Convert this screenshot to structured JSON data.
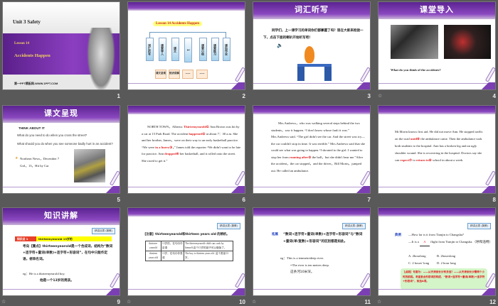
{
  "slides": [
    {
      "number": "1",
      "title": "Unit 3  Safety",
      "lesson": "Lesson 14",
      "subtitle": "Accidents Happen",
      "footer": "第一PPT模板网-WWW.1PPT.COM"
    },
    {
      "number": "2",
      "banner": "Lesson 14   Accidents Happen",
      "boxes": [
        "词汇听写",
        "课堂导入",
        "课文",
        "1",
        "课堂小结",
        "课堂练习",
        "课后作业"
      ],
      "sub_boxes": [
        "课文呈现",
        "知识讲解",
        "——",
        "——"
      ]
    },
    {
      "number": "3",
      "header": "词汇听写",
      "text": "同学们，上一课学习的单词你们都掌握了吗？现在大家来检验一下，点击下面的喇叭开始听写吧！"
    },
    {
      "number": "4",
      "header": "课堂导入",
      "caption": "What do you think of the accidents?"
    },
    {
      "number": "5",
      "header": "课文呈现",
      "think": "THINK  ABOUT  IT",
      "q1": "What do you need to do when you cross the street?",
      "q2": "What should you do when you see someone badly hurt in an accident?",
      "news1": "Northern News，December 7",
      "news2": "Girl，13，Hit by Car"
    },
    {
      "number": "6",
      "segments": [
        {
          "t": "NORTH TOWN，Alberta: "
        },
        {
          "t": "Thirteenyearold①",
          "hl": true
        },
        {
          "t": " Ann Brown was hit by a car at 15 Park Road. The accident "
        },
        {
          "t": "happened②",
          "hl": true
        },
        {
          "t": " at about 7：30 a.m. She and her brother, James，were on their way to an early basketball practice. “We were "
        },
        {
          "t": "in a hurry③",
          "hl": true
        },
        {
          "t": "，” James told the reporter.“We didn't want to be late for practice. Ann "
        },
        {
          "t": "dropped④",
          "hl": true
        },
        {
          "t": " her basketball, and it rolled onto the street. She raced to get it.”"
        }
      ]
    },
    {
      "number": "7",
      "segments": [
        {
          "t": "Mrs.Andrews，who was walking several steps behind the two students，saw it happen. “I don't know whose fault it was.” Mrs.Andrews said. “The girl didn't see the car. And the street was icy—the car couldn't stop in time. It was terrible.” Mrs.Andrews said that she could see what was going to happen.“I shouted to the girl. I wanted to stop her from "
        },
        {
          "t": "running after⑤",
          "hl": true
        },
        {
          "t": " the ball，but she didn't hear me.”After the accident，the car stopped，and the driver，Bill Morin，jumped out. He called an ambulance."
        }
      ]
    },
    {
      "number": "8",
      "segments": [
        {
          "t": "Mr.Morin knows first aid. He did not move Ann. He stopped traffic on the road "
        },
        {
          "t": "until⑥",
          "hl": true
        },
        {
          "t": " the ambulance came. Then the ambulance took both students to the hospital. Ann has a broken leg and an ugly shoulder wound. She is recovering in the hospital. Doctors say she can "
        },
        {
          "t": "expect⑦",
          "hl": true
        },
        {
          "t": " to "
        },
        {
          "t": "return to⑧",
          "hl": true
        },
        {
          "t": " school in about a week."
        }
      ]
    },
    {
      "number": "9",
      "header": "知识讲解",
      "tag": "精讲点拨 (冀教)",
      "point_label": "知识点 1",
      "point": "thirteenyearold  13岁的",
      "body": "考向【重点】thirteenyearold是一个合成词，结构为“数词+连字符+量词(单数)+连字符+形容词”，在句中只能作定语，修饰名词。",
      "eg": "eg：He is a thirteenyearold boy.",
      "eg_cn": "他是一个13岁的男孩。"
    },
    {
      "number": "10",
      "tag": "精讲点拨 (冀教)",
      "note": "【注意】thirteenyearold和thirteen years old 的辨析。",
      "table": [
        [
          "thirteen-yearold",
          "13岁的，在句中作定语",
          "The thirteenyearold child can cook by himself.这个13岁的孩子可以做饭了。"
        ],
        [
          "thirteen years old",
          "13岁，在句中作表语",
          "The boy is thirteen years old. 这个男孩13岁。"
        ]
      ]
    },
    {
      "number": "11",
      "tag": "精讲点拨 (冀教)",
      "label": "拓展",
      "body": "“数词+连字符+量词(单数)+连字符+形容词”与“数词+量词(单/复数)+形容词”的区别都是如此。",
      "eg": "eg：This is a tenmetredeep river.",
      "eg2": "=The river is ten metres deep.",
      "eg_cn": "这条河10米深。"
    },
    {
      "number": "12",
      "tag": "精讲点拨 (冀教)",
      "label": "典例",
      "q1": "—How far is it from Tianjin to Changsha?",
      "q2a": "—It is a ",
      "answer": "A",
      "q2b": " flight from Tianjin to Changsha.（呼和浩特）",
      "options": [
        "A. 2hourlong",
        "B. 2hourslong",
        "C. 2 hours' long",
        "D. 2 hour long"
      ],
      "explain": "【点拨】句意为：——从天津到长沙有多远？——从天津到长沙需两个小时的航程。考查复合形容词的构成，“数词+连字符+量词(单数)+连字符+形容词”，故选A项。"
    }
  ],
  "colors": {
    "purple": "#7b3fb3",
    "highlight": "#e02020",
    "background": "#595959"
  }
}
